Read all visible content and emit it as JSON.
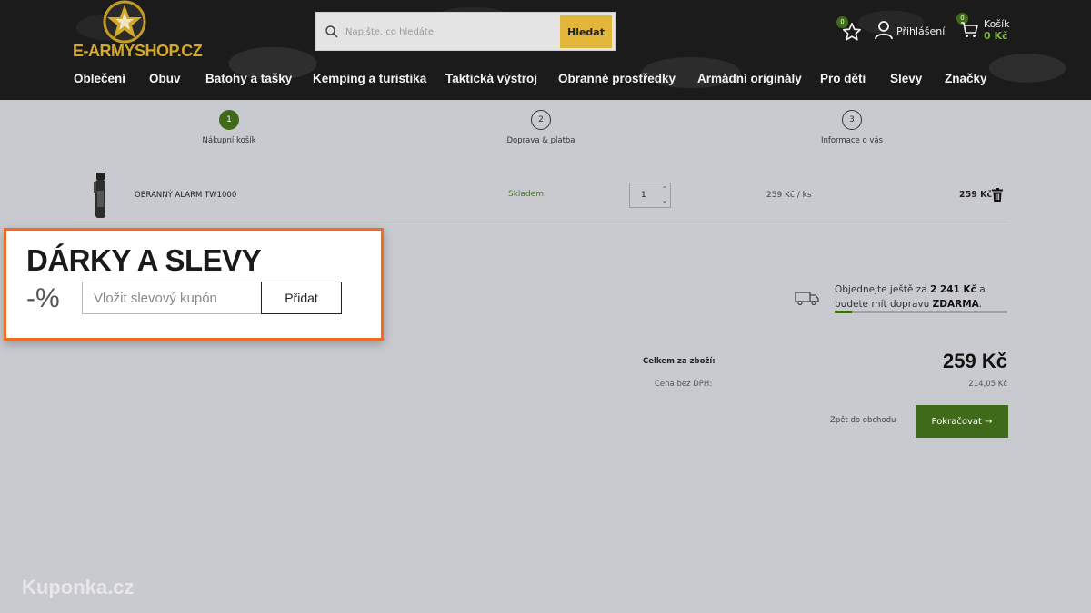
{
  "header": {
    "logo_text": "E-ARMYSHOP.CZ",
    "search": {
      "placeholder": "Napište, co hledáte",
      "button_label": "Hledat"
    },
    "wishlist_count": "0",
    "login_label": "Přihlášení",
    "cart": {
      "count": "0",
      "label": "Košík",
      "total": "0 Kč"
    }
  },
  "nav": [
    "Oblečení",
    "Obuv",
    "Batohy a tašky",
    "Kemping a turistika",
    "Taktická výstroj",
    "Obranné prostředky",
    "Armádní originály",
    "Pro děti",
    "Slevy",
    "Značky"
  ],
  "steps": [
    {
      "number": "1",
      "label": "Nákupní košík"
    },
    {
      "number": "2",
      "label": "Doprava & platba"
    },
    {
      "number": "3",
      "label": "Informace o vás"
    }
  ],
  "cart_item": {
    "name": "OBRANNÝ ALARM TW1000",
    "stock": "Skladem",
    "quantity": "1",
    "unit_price": "259 Kč  / ks",
    "total": "259 Kč"
  },
  "coupon": {
    "title": "DÁRKY A SLEVY",
    "percent_symbol": "-%",
    "placeholder": "Vložit slevový kupón",
    "button_label": "Přidat"
  },
  "shipping": {
    "line1_prefix": "Objednejte ještě za ",
    "amount": "2 241 Kč",
    "line1_suffix": " a",
    "line2_prefix": "budete mít dopravu ",
    "free": "ZDARMA",
    "line2_suffix": ".",
    "progress_fraction": 0.1
  },
  "totals": {
    "goods_label": "Celkem za zboží:",
    "goods_value": "259 Kč",
    "net_label": "Cena bez DPH:",
    "net_value": "214,05 Kč"
  },
  "actions": {
    "back_label": "Zpět do obchodu",
    "continue_label": "Pokračovat →"
  },
  "watermark": "Kuponka.cz",
  "colors": {
    "accent_green": "#3f6a1a",
    "search_yellow": "#e2b63b",
    "callout_orange": "#f26b21"
  }
}
